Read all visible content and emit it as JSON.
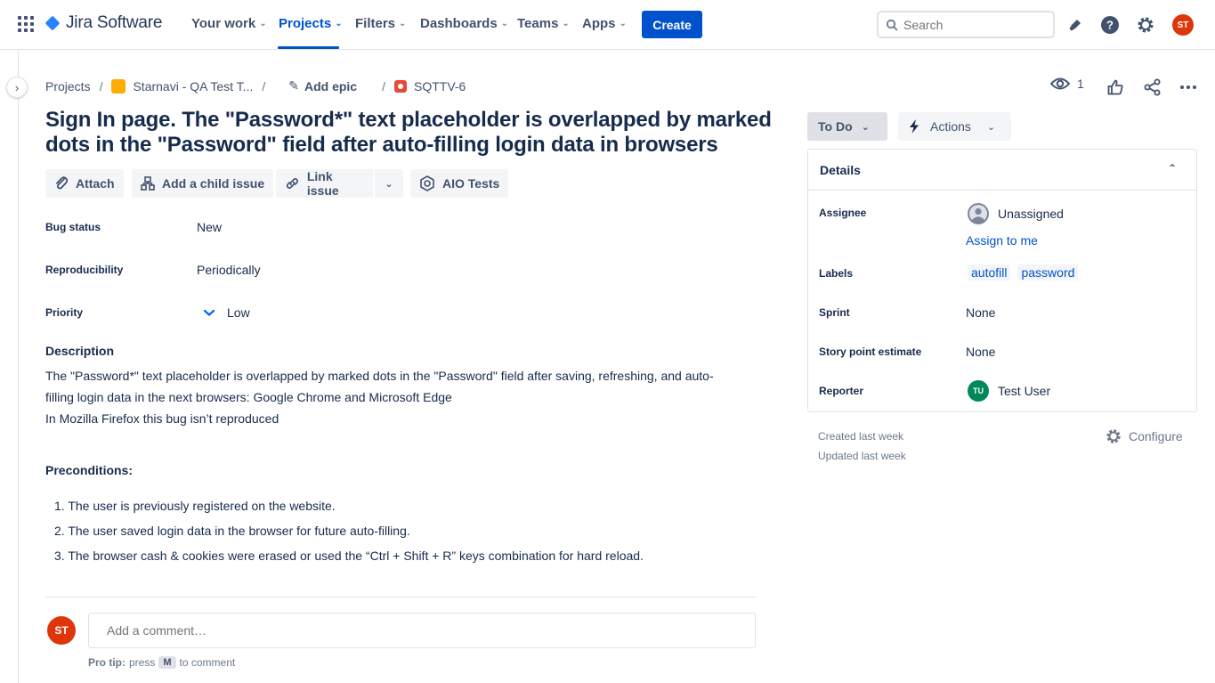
{
  "nav": {
    "brand": "Jira Software",
    "items": [
      {
        "label": "Your work"
      },
      {
        "label": "Projects"
      },
      {
        "label": "Filters"
      },
      {
        "label": "Dashboards"
      },
      {
        "label": "Teams"
      },
      {
        "label": "Apps"
      }
    ],
    "create_label": "Create",
    "search_placeholder": "Search",
    "user_initials": "ST"
  },
  "breadcrumb": {
    "projects": "Projects",
    "project": "Starnavi - QA Test T...",
    "epic": "Add epic",
    "issue_key": "SQTTV-6"
  },
  "header": {
    "watch_count": "1"
  },
  "issue": {
    "title": "Sign In page. The \"Password*\" text placeholder is overlapped by marked dots in the \"Password\" field after auto-filling login data in browsers",
    "actions": {
      "attach": "Attach",
      "child": "Add a child issue",
      "link": "Link issue",
      "aio": "AIO Tests"
    },
    "fields": {
      "bug_status_label": "Bug status",
      "bug_status": "New",
      "repro_label": "Reproducibility",
      "repro": "Periodically",
      "priority_label": "Priority",
      "priority": "Low"
    },
    "description_heading": "Description",
    "description_lines": [
      "The \"Password*\" text placeholder is overlapped by marked dots in the \"Password\" field after saving, refreshing, and auto-",
      "filling login data in the next browsers: Google Chrome and Microsoft Edge",
      "In Mozilla Firefox this bug isn’t reproduced"
    ],
    "preconditions_heading": "Preconditions:",
    "preconditions": [
      "1. The user is previously registered on the website.",
      "2. The user saved login data in the browser for future auto-filling.",
      "3. The browser cash & cookies were erased or used the “Ctrl + Shift + R” keys combination for hard reload."
    ]
  },
  "comment": {
    "placeholder": "Add a comment…",
    "protip_bold": "Pro tip:",
    "protip_press": "press",
    "protip_key": "M",
    "protip_suffix": "to comment"
  },
  "side": {
    "status": "To Do",
    "actions": "Actions",
    "details_title": "Details",
    "assignee_label": "Assignee",
    "assignee": "Unassigned",
    "assign_me": "Assign to me",
    "labels_label": "Labels",
    "labels": [
      "autofill",
      "password"
    ],
    "sprint_label": "Sprint",
    "sprint": "None",
    "story_label": "Story point estimate",
    "story": "None",
    "reporter_label": "Reporter",
    "reporter": "Test User",
    "reporter_initials": "TU",
    "created": "Created last week",
    "updated": "Updated last week",
    "configure": "Configure"
  },
  "colors": {
    "primary": "#0052cc",
    "avatar_st": "#de350b",
    "avatar_tu": "#00875a"
  }
}
